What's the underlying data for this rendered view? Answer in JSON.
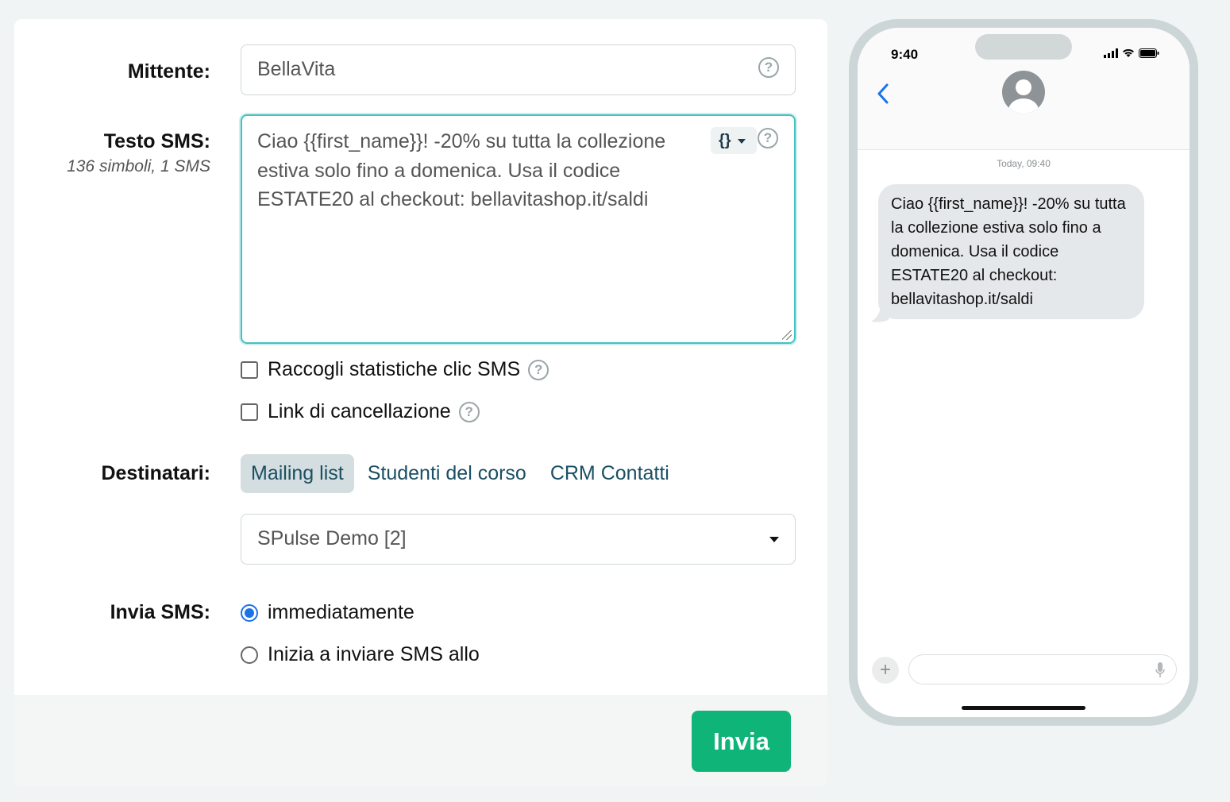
{
  "form": {
    "sender_label": "Mittente:",
    "sender_value": "BellaVita",
    "sms_text_label": "Testo SMS:",
    "sms_counter": "136 simboli, 1 SMS",
    "sms_text_value": "Ciao {{first_name}}! -20% su tutta la collezione estiva solo fino a domenica. Usa il codice ESTATE20 al checkout: bellavitashop.it/saldi",
    "variable_button_label": "{}",
    "track_clicks_label": "Raccogli statistiche clic SMS",
    "unsubscribe_link_label": "Link di cancellazione",
    "recipients_label": "Destinatari:",
    "recipient_tabs": [
      "Mailing list",
      "Studenti del corso",
      "CRM Contatti"
    ],
    "mailing_list_selected": "SPulse Demo [2]",
    "send_sms_label": "Invia SMS:",
    "send_options": [
      "immediatamente",
      "Inizia a inviare SMS allo"
    ],
    "send_button_label": "Invia",
    "help_glyph": "?"
  },
  "phone": {
    "status_time": "9:40",
    "timestamp": "Today, 09:40",
    "message": "Ciao {{first_name}}! -20% su tutta la collezione estiva solo fino a domenica. Usa il codice ESTATE20 al checkout: bellavitashop.it/saldi",
    "plus_glyph": "+"
  },
  "colors": {
    "accent_teal": "#46c1c0",
    "send_green": "#0fb578",
    "tab_active_bg": "#d4dddf",
    "radio_blue": "#1a73e8",
    "ios_blue": "#1a73e8"
  },
  "icons": [
    "help-icon",
    "chevron-left-icon",
    "avatar-icon",
    "signal-icon",
    "wifi-icon",
    "battery-icon",
    "mic-icon",
    "plus-icon",
    "caret-down-icon"
  ]
}
